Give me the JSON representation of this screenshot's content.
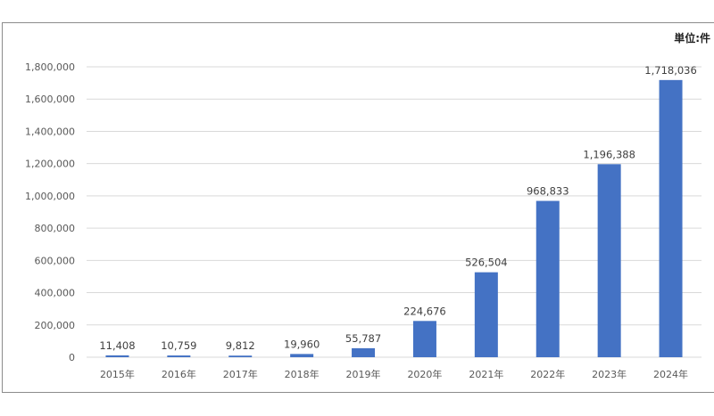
{
  "unit_label": "単位:件",
  "chart_data": {
    "type": "bar",
    "categories": [
      "2015年",
      "2016年",
      "2017年",
      "2018年",
      "2019年",
      "2020年",
      "2021年",
      "2022年",
      "2023年",
      "2024年"
    ],
    "values": [
      11408,
      10759,
      9812,
      19960,
      55787,
      224676,
      526504,
      968833,
      1196388,
      1718036
    ],
    "data_labels": [
      "11,408",
      "10,759",
      "9,812",
      "19,960",
      "55,787",
      "224,676",
      "526,504",
      "968,833",
      "1,196,388",
      "1,718,036"
    ],
    "ylim": [
      0,
      1800000
    ],
    "yticks": [
      0,
      200000,
      400000,
      600000,
      800000,
      1000000,
      1200000,
      1400000,
      1600000,
      1800000
    ],
    "ytick_labels": [
      "0",
      "200,000",
      "400,000",
      "600,000",
      "800,000",
      "1,000,000",
      "1,200,000",
      "1,400,000",
      "1,600,000",
      "1,800,000"
    ],
    "grid": true,
    "legend": "none",
    "bar_color": "#4472c4",
    "grid_color": "#d9d9d9"
  }
}
